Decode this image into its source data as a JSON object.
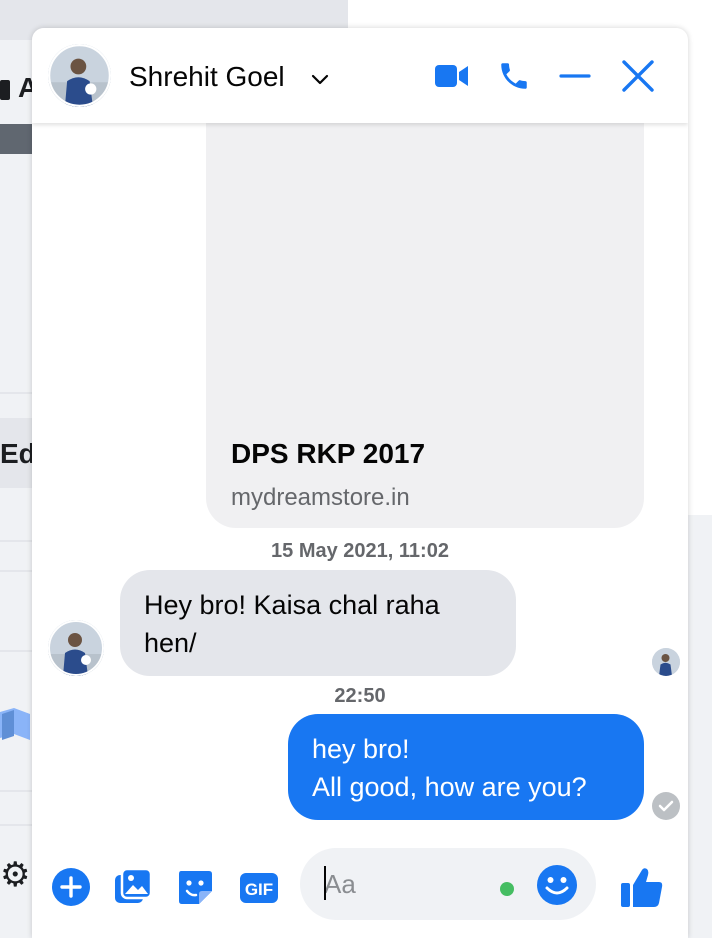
{
  "background": {
    "letter_a": "A",
    "letters_ed": "Edi"
  },
  "chat": {
    "contact_name": "Shrehit Goel",
    "link_preview": {
      "title": "DPS RKP 2017",
      "url": "mydreamstore.in"
    },
    "timestamp_1": "15 May 2021, 11:02",
    "incoming_message": "Hey bro! Kaisa chal raha hen/",
    "timestamp_2": "22:50",
    "outgoing_message": {
      "line_1": "hey bro!",
      "line_2": "All good, how are you?"
    },
    "composer": {
      "placeholder": "Aa",
      "gif_label": "GIF"
    }
  },
  "colors": {
    "accent": "#1877f2",
    "bubble_in": "#e4e6eb",
    "bubble_out": "#1877f2",
    "active_dot": "#45bd62",
    "muted_text": "#65676b"
  },
  "icons": {
    "header": [
      "video-call-icon",
      "phone-call-icon",
      "minimize-icon",
      "close-icon"
    ],
    "composer": [
      "plus-circle-icon",
      "photo-icon",
      "sticker-icon",
      "gif-icon",
      "emoji-icon",
      "thumbs-up-icon"
    ]
  }
}
